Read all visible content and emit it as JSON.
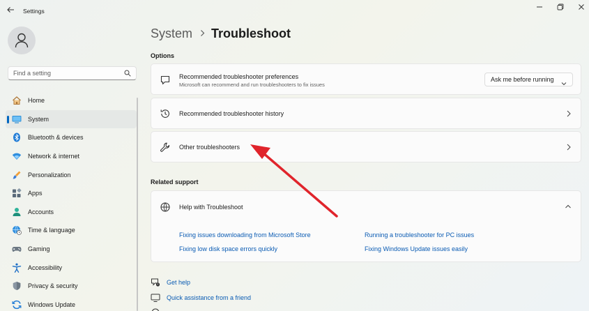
{
  "window": {
    "title": "Settings",
    "back_icon": "back-arrow-icon",
    "controls": [
      "minimize-icon",
      "maximize-icon",
      "close-icon"
    ]
  },
  "sidebar": {
    "avatar_icon": "user-avatar-icon",
    "search": {
      "placeholder": "Find a setting",
      "value": ""
    },
    "items": [
      {
        "label": "Home",
        "icon": "home-icon",
        "active": false
      },
      {
        "label": "System",
        "icon": "system-display-icon",
        "active": true
      },
      {
        "label": "Bluetooth & devices",
        "icon": "bluetooth-icon",
        "active": false
      },
      {
        "label": "Network & internet",
        "icon": "wifi-icon",
        "active": false
      },
      {
        "label": "Personalization",
        "icon": "paintbrush-icon",
        "active": false
      },
      {
        "label": "Apps",
        "icon": "apps-icon",
        "active": false
      },
      {
        "label": "Accounts",
        "icon": "accounts-icon",
        "active": false
      },
      {
        "label": "Time & language",
        "icon": "globe-clock-icon",
        "active": false
      },
      {
        "label": "Gaming",
        "icon": "gamepad-icon",
        "active": false
      },
      {
        "label": "Accessibility",
        "icon": "accessibility-icon",
        "active": false
      },
      {
        "label": "Privacy & security",
        "icon": "shield-icon",
        "active": false
      },
      {
        "label": "Windows Update",
        "icon": "windows-update-icon",
        "active": false
      }
    ]
  },
  "main": {
    "breadcrumb": {
      "parent": "System",
      "current": "Troubleshoot"
    },
    "options_label": "Options",
    "cards": [
      {
        "title": "Recommended troubleshooter preferences",
        "subtitle": "Microsoft can recommend and run troubleshooters to fix issues",
        "icon": "chat-bubble-icon",
        "dropdown_value": "Ask me before running"
      },
      {
        "title": "Recommended troubleshooter history",
        "icon": "history-icon"
      },
      {
        "title": "Other troubleshooters",
        "icon": "wrench-icon"
      }
    ],
    "related_label": "Related support",
    "help": {
      "title": "Help with Troubleshoot",
      "icon": "globe-icon",
      "links": [
        "Fixing issues downloading from Microsoft Store",
        "Running a troubleshooter for PC issues",
        "Fixing low disk space errors quickly",
        "Fixing Windows Update issues easily"
      ]
    },
    "footer": [
      {
        "label": "Get help",
        "icon": "get-help-icon"
      },
      {
        "label": "Quick assistance from a friend",
        "icon": "quick-assist-icon"
      }
    ]
  },
  "annotation": {
    "color": "#e0242b",
    "icon": "red-arrow"
  },
  "colors": {
    "accent": "#0067c0",
    "link": "#0a5bb3"
  }
}
